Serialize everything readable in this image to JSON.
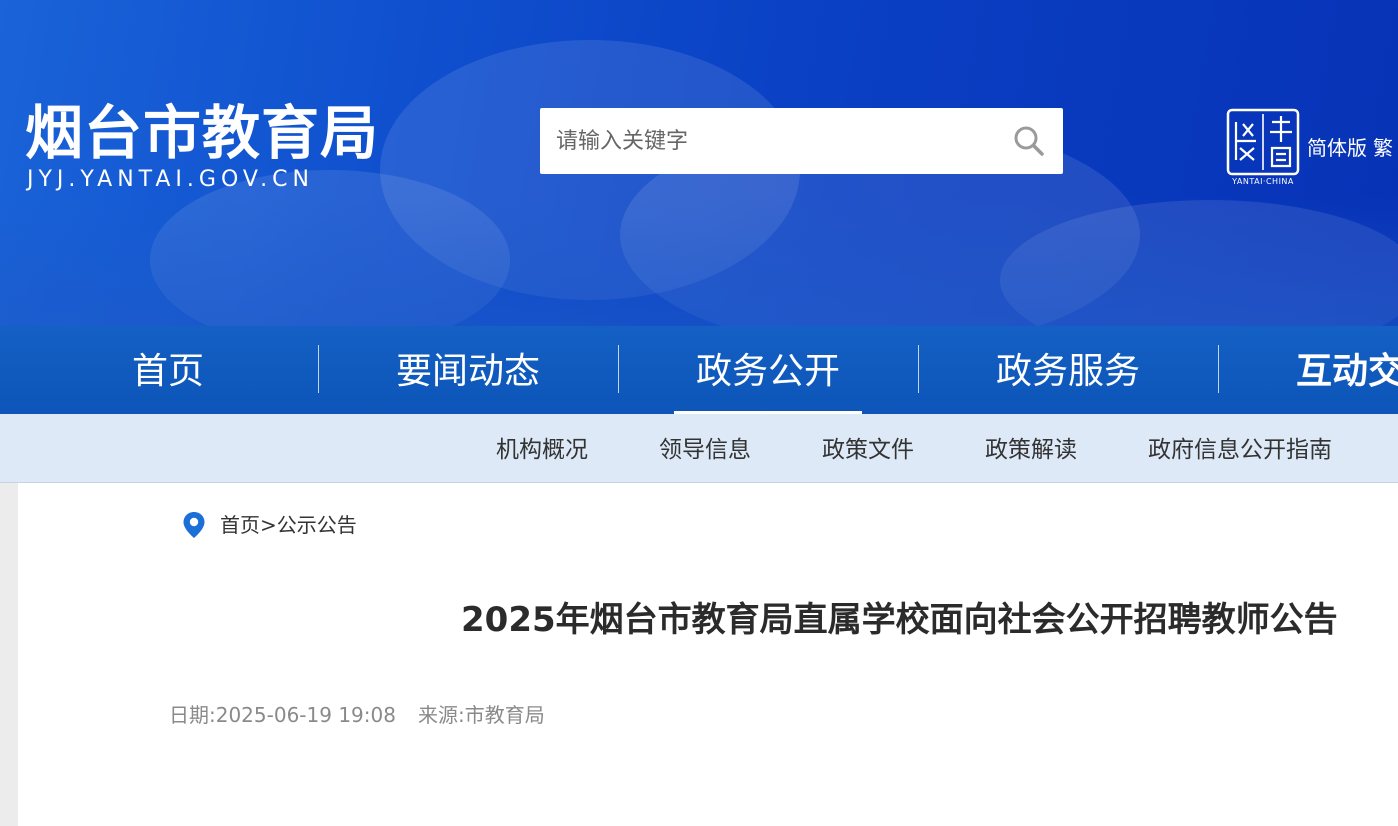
{
  "header": {
    "site_title": "烟台市教育局",
    "site_domain": "JYJ.YANTAI.GOV.CN",
    "search_placeholder": "请输入关键字",
    "logo_caption": "YANTAI·CHINA",
    "lang_simplified": "简体版",
    "lang_traditional": "繁"
  },
  "main_nav": {
    "items": [
      {
        "label": "首页"
      },
      {
        "label": "要闻动态"
      },
      {
        "label": "政务公开"
      },
      {
        "label": "政务服务"
      },
      {
        "label": "互动交"
      }
    ],
    "active_index": 2
  },
  "sub_nav": {
    "items": [
      {
        "label": "机构概况"
      },
      {
        "label": "领导信息"
      },
      {
        "label": "政策文件"
      },
      {
        "label": "政策解读"
      },
      {
        "label": "政府信息公开指南"
      }
    ]
  },
  "breadcrumb": {
    "home": "首页",
    "separator": ">",
    "current": "公示公告"
  },
  "article": {
    "title": "2025年烟台市教育局直属学校面向社会公开招聘教师公告",
    "date": "日期:2025-06-19 19:08",
    "source": "来源:市教育局"
  },
  "colors": {
    "banner_blue": "#0a3fc3",
    "nav_blue": "#1460c4",
    "subnav_bg": "#dde9f7",
    "pin_blue": "#1d6fd8"
  },
  "icons": {
    "search": "search-icon",
    "location": "location-pin-icon",
    "logo": "yantai-seal-logo"
  }
}
